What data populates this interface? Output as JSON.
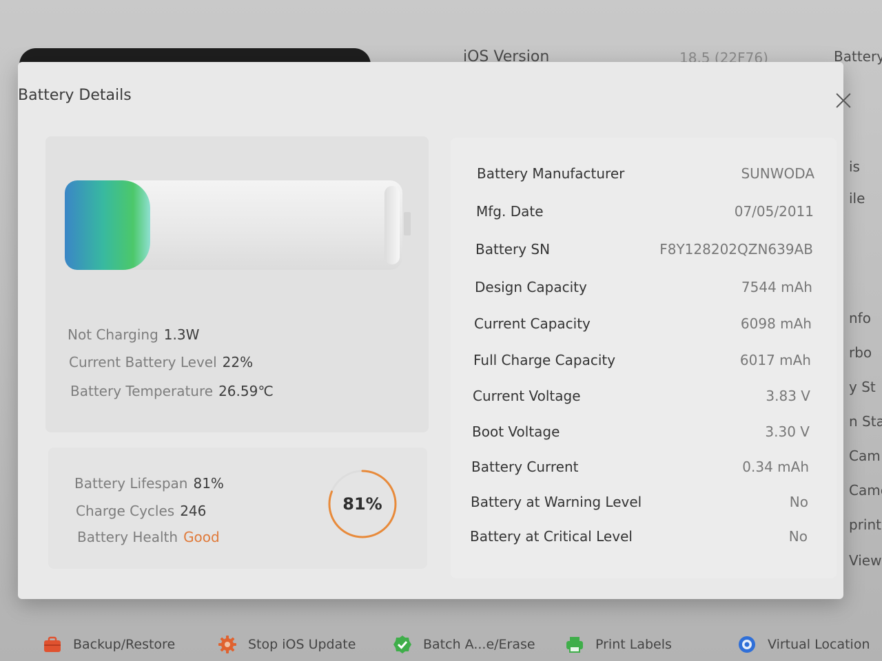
{
  "background": {
    "ios_version_label": "iOS Version",
    "ios_version_value": "18.5 (22F76)",
    "battery_tab": "Battery",
    "right_fragments": [
      "is",
      "ile",
      "nfo",
      "rbo",
      "y St",
      "n Sta",
      "Cam",
      "Came",
      "print",
      "View"
    ]
  },
  "modal": {
    "title": "Battery Details",
    "charging": {
      "label": "Not Charging",
      "value": "1.3W"
    },
    "level": {
      "label": "Current Battery Level",
      "value": "22%",
      "fraction": 0.22
    },
    "temperature": {
      "label": "Battery Temperature",
      "value": "26.59℃"
    },
    "lifespan": {
      "label": "Battery Lifespan",
      "value": "81%",
      "fraction": 0.81
    },
    "cycles": {
      "label": "Charge Cycles",
      "value": "246"
    },
    "health": {
      "label": "Battery Health",
      "value": "Good"
    },
    "ring_text": "81%",
    "details": [
      {
        "key": "Battery Manufacturer",
        "value": "SUNWODA"
      },
      {
        "key": "Mfg. Date",
        "value": "07/05/2011"
      },
      {
        "key": "Battery SN",
        "value": "F8Y128202QZN639AB"
      },
      {
        "key": "Design Capacity",
        "value": "7544 mAh"
      },
      {
        "key": "Current Capacity",
        "value": "6098 mAh"
      },
      {
        "key": "Full Charge Capacity",
        "value": "6017 mAh"
      },
      {
        "key": "Current Voltage",
        "value": "3.83 V"
      },
      {
        "key": "Boot Voltage",
        "value": "3.30 V"
      },
      {
        "key": "Battery Current",
        "value": "0.34 mAh"
      },
      {
        "key": "Battery at Warning Level",
        "value": "No"
      },
      {
        "key": "Battery at Critical Level",
        "value": "No"
      }
    ]
  },
  "toolbar": {
    "items": [
      {
        "label": "Backup/Restore",
        "icon": "briefcase-icon",
        "color": "#e0522f"
      },
      {
        "label": "Stop iOS Update",
        "icon": "gear-icon",
        "color": "#e0622f"
      },
      {
        "label": "Batch A...e/Erase",
        "icon": "check-badge-icon",
        "color": "#3fae4a"
      },
      {
        "label": "Print Labels",
        "icon": "printer-icon",
        "color": "#3fae4a"
      },
      {
        "label": "Virtual Location",
        "icon": "location-pin-icon",
        "color": "#2f6fd8"
      }
    ]
  },
  "colors": {
    "accent_orange": "#e07a3a",
    "ring": "#e88a3a"
  }
}
